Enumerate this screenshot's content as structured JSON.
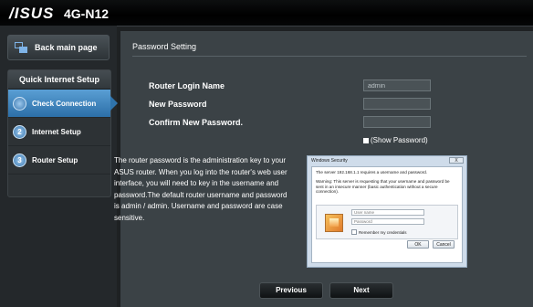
{
  "header": {
    "brand": "/ISUS",
    "model": "4G-N12"
  },
  "sidebar": {
    "back_label": "Back main page",
    "menu_title": "Quick Internet Setup",
    "steps": [
      {
        "num": "1",
        "label": "Check Connection",
        "active": true
      },
      {
        "num": "2",
        "label": "Internet Setup",
        "active": false
      },
      {
        "num": "3",
        "label": "Router Setup",
        "active": false
      }
    ]
  },
  "main": {
    "title": "Password Setting",
    "fields": {
      "login_name_label": "Router Login Name",
      "login_name_value": "admin",
      "new_password_label": "New Password",
      "new_password_value": "",
      "confirm_label": "Confirm New Password.",
      "confirm_value": ""
    },
    "show_password_label": "(Show Password)",
    "description": "The router password is the administration key to your ASUS router. When you log into the router's web user interface, you will need to key in the username and password.The default router username and password is admin / admin. Username and password are case sensitive.",
    "buttons": {
      "previous": "Previous",
      "next": "Next"
    }
  },
  "dialog": {
    "title": "Windows Security",
    "close": "X",
    "message": "The server 192.168.1.1 requires a username and password.",
    "warning": "Warning: This server is requesting that your username and password be sent in an insecure manner (basic authentication without a secure connection).",
    "username_placeholder": "User name",
    "password_placeholder": "Password",
    "remember": "Remember my credentials",
    "ok": "OK",
    "cancel": "Cancel"
  },
  "colors": {
    "accent": "#3f86c4",
    "panel": "#3b4246",
    "sidebar": "#24282b"
  }
}
